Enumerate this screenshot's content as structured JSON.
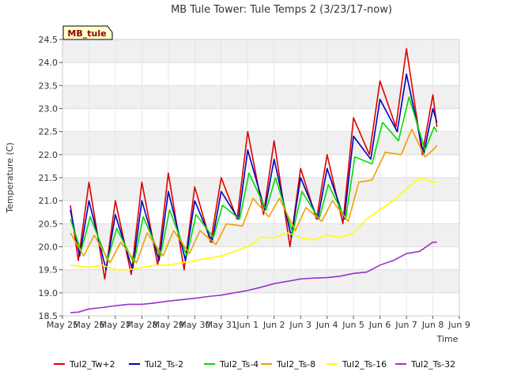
{
  "chart_data": {
    "type": "line",
    "title": "MB Tule Tower: Tule Temps 2 (3/23/17-now)",
    "xlabel": "Time",
    "ylabel": "Temperature (C)",
    "xlim": [
      0,
      15
    ],
    "ylim": [
      18.5,
      24.5
    ],
    "x_ticks": [
      0,
      1,
      2,
      3,
      4,
      5,
      6,
      7,
      8,
      9,
      10,
      11,
      12,
      13,
      14,
      15
    ],
    "x_tick_labels": [
      "May 25",
      "May 26",
      "May 27",
      "May 28",
      "May 29",
      "May 30",
      "May 31",
      "Jun 1",
      "Jun 2",
      "Jun 3",
      "Jun 4",
      "Jun 5",
      "Jun 6",
      "Jun 7",
      "Jun 8",
      "Jun 9"
    ],
    "y_ticks": [
      18.5,
      19.0,
      19.5,
      20.0,
      20.5,
      21.0,
      21.5,
      22.0,
      22.5,
      23.0,
      23.5,
      24.0,
      24.5
    ],
    "y_tick_labels": [
      "18.5",
      "19.0",
      "19.5",
      "20.0",
      "20.5",
      "21.0",
      "21.5",
      "22.0",
      "22.5",
      "23.0",
      "23.5",
      "24.0",
      "24.5"
    ],
    "grid": true,
    "legend_position": "bottom",
    "site_tag": "MB_tule",
    "series": [
      {
        "name": "Tul2_Tw+2",
        "color": "#dd0000",
        "points": [
          [
            0.3,
            20.9
          ],
          [
            0.6,
            19.7
          ],
          [
            1.0,
            21.4
          ],
          [
            1.6,
            19.3
          ],
          [
            2.0,
            21.0
          ],
          [
            2.6,
            19.4
          ],
          [
            3.0,
            21.4
          ],
          [
            3.6,
            19.6
          ],
          [
            4.0,
            21.6
          ],
          [
            4.6,
            19.5
          ],
          [
            5.0,
            21.3
          ],
          [
            5.6,
            20.1
          ],
          [
            6.0,
            21.5
          ],
          [
            6.6,
            20.6
          ],
          [
            7.0,
            22.5
          ],
          [
            7.6,
            20.7
          ],
          [
            8.0,
            22.3
          ],
          [
            8.6,
            20.0
          ],
          [
            9.0,
            21.7
          ],
          [
            9.6,
            20.6
          ],
          [
            10.0,
            22.0
          ],
          [
            10.6,
            20.5
          ],
          [
            11.0,
            22.8
          ],
          [
            11.6,
            22.0
          ],
          [
            12.0,
            23.6
          ],
          [
            12.6,
            22.6
          ],
          [
            13.0,
            24.3
          ],
          [
            13.6,
            22.0
          ],
          [
            14.0,
            23.3
          ],
          [
            14.15,
            22.6
          ]
        ]
      },
      {
        "name": "Tul2_Ts-2",
        "color": "#0000bb",
        "points": [
          [
            0.3,
            20.8
          ],
          [
            0.65,
            19.8
          ],
          [
            1.0,
            21.0
          ],
          [
            1.65,
            19.5
          ],
          [
            2.0,
            20.7
          ],
          [
            2.65,
            19.5
          ],
          [
            3.0,
            21.0
          ],
          [
            3.65,
            19.7
          ],
          [
            4.0,
            21.2
          ],
          [
            4.65,
            19.7
          ],
          [
            5.0,
            21.0
          ],
          [
            5.65,
            20.1
          ],
          [
            6.0,
            21.2
          ],
          [
            6.65,
            20.6
          ],
          [
            7.0,
            22.1
          ],
          [
            7.65,
            20.8
          ],
          [
            8.0,
            21.9
          ],
          [
            8.65,
            20.2
          ],
          [
            9.0,
            21.5
          ],
          [
            9.65,
            20.6
          ],
          [
            10.0,
            21.7
          ],
          [
            10.65,
            20.6
          ],
          [
            11.0,
            22.4
          ],
          [
            11.65,
            21.9
          ],
          [
            12.0,
            23.2
          ],
          [
            12.65,
            22.5
          ],
          [
            13.0,
            23.75
          ],
          [
            13.65,
            22.0
          ],
          [
            14.0,
            23.0
          ],
          [
            14.15,
            22.7
          ]
        ]
      },
      {
        "name": "Tul2_Ts-4",
        "color": "#00dd00",
        "points": [
          [
            0.3,
            20.6
          ],
          [
            0.7,
            19.9
          ],
          [
            1.05,
            20.65
          ],
          [
            1.7,
            19.7
          ],
          [
            2.05,
            20.4
          ],
          [
            2.7,
            19.65
          ],
          [
            3.05,
            20.65
          ],
          [
            3.7,
            19.8
          ],
          [
            4.05,
            20.8
          ],
          [
            4.7,
            19.8
          ],
          [
            5.05,
            20.7
          ],
          [
            5.7,
            20.2
          ],
          [
            6.05,
            20.9
          ],
          [
            6.7,
            20.6
          ],
          [
            7.05,
            21.6
          ],
          [
            7.7,
            20.8
          ],
          [
            8.05,
            21.5
          ],
          [
            8.7,
            20.3
          ],
          [
            9.05,
            21.2
          ],
          [
            9.7,
            20.6
          ],
          [
            10.05,
            21.35
          ],
          [
            10.7,
            20.6
          ],
          [
            11.05,
            21.95
          ],
          [
            11.7,
            21.8
          ],
          [
            12.1,
            22.7
          ],
          [
            12.7,
            22.3
          ],
          [
            13.1,
            23.25
          ],
          [
            13.7,
            22.1
          ],
          [
            14.05,
            22.6
          ],
          [
            14.15,
            22.5
          ]
        ]
      },
      {
        "name": "Tul2_Ts-8",
        "color": "#f0a000",
        "points": [
          [
            0.3,
            20.3
          ],
          [
            0.8,
            19.8
          ],
          [
            1.2,
            20.25
          ],
          [
            1.8,
            19.65
          ],
          [
            2.2,
            20.1
          ],
          [
            2.8,
            19.65
          ],
          [
            3.2,
            20.3
          ],
          [
            3.8,
            19.8
          ],
          [
            4.2,
            20.35
          ],
          [
            4.8,
            19.85
          ],
          [
            5.2,
            20.35
          ],
          [
            5.8,
            20.05
          ],
          [
            6.2,
            20.5
          ],
          [
            6.8,
            20.45
          ],
          [
            7.2,
            21.05
          ],
          [
            7.8,
            20.65
          ],
          [
            8.2,
            21.05
          ],
          [
            8.8,
            20.35
          ],
          [
            9.2,
            20.85
          ],
          [
            9.8,
            20.55
          ],
          [
            10.2,
            21.0
          ],
          [
            10.8,
            20.55
          ],
          [
            11.2,
            21.4
          ],
          [
            11.7,
            21.45
          ],
          [
            12.2,
            22.05
          ],
          [
            12.8,
            22.0
          ],
          [
            13.2,
            22.55
          ],
          [
            13.7,
            21.95
          ],
          [
            14.0,
            22.1
          ],
          [
            14.15,
            22.2
          ]
        ]
      },
      {
        "name": "Tul2_Ts-16",
        "color": "#ffff00",
        "points": [
          [
            0.3,
            19.6
          ],
          [
            1.0,
            19.55
          ],
          [
            1.5,
            19.6
          ],
          [
            2.0,
            19.5
          ],
          [
            2.5,
            19.5
          ],
          [
            3.0,
            19.55
          ],
          [
            3.5,
            19.6
          ],
          [
            4.0,
            19.6
          ],
          [
            4.5,
            19.65
          ],
          [
            5.0,
            19.7
          ],
          [
            5.5,
            19.75
          ],
          [
            6.0,
            19.8
          ],
          [
            6.5,
            19.9
          ],
          [
            7.0,
            20.0
          ],
          [
            7.5,
            20.2
          ],
          [
            8.0,
            20.2
          ],
          [
            8.5,
            20.3
          ],
          [
            9.0,
            20.2
          ],
          [
            9.5,
            20.15
          ],
          [
            10.0,
            20.25
          ],
          [
            10.5,
            20.2
          ],
          [
            11.0,
            20.3
          ],
          [
            11.5,
            20.6
          ],
          [
            12.0,
            20.8
          ],
          [
            12.5,
            21.0
          ],
          [
            13.0,
            21.25
          ],
          [
            13.5,
            21.5
          ],
          [
            14.0,
            21.4
          ],
          [
            14.15,
            21.4
          ]
        ]
      },
      {
        "name": "Tul2_Ts-32",
        "color": "#9933cc",
        "points": [
          [
            0.3,
            18.57
          ],
          [
            0.6,
            18.58
          ],
          [
            1.0,
            18.65
          ],
          [
            1.5,
            18.68
          ],
          [
            2.0,
            18.72
          ],
          [
            2.5,
            18.75
          ],
          [
            3.0,
            18.75
          ],
          [
            3.5,
            18.78
          ],
          [
            4.0,
            18.82
          ],
          [
            4.5,
            18.85
          ],
          [
            5.0,
            18.88
          ],
          [
            5.5,
            18.92
          ],
          [
            6.0,
            18.95
          ],
          [
            6.5,
            19.0
          ],
          [
            7.0,
            19.05
          ],
          [
            7.5,
            19.12
          ],
          [
            8.0,
            19.2
          ],
          [
            8.5,
            19.25
          ],
          [
            9.0,
            19.3
          ],
          [
            9.5,
            19.32
          ],
          [
            10.0,
            19.33
          ],
          [
            10.5,
            19.36
          ],
          [
            11.0,
            19.42
          ],
          [
            11.5,
            19.45
          ],
          [
            12.0,
            19.6
          ],
          [
            12.5,
            19.7
          ],
          [
            13.0,
            19.85
          ],
          [
            13.5,
            19.9
          ],
          [
            14.0,
            20.1
          ],
          [
            14.15,
            20.1
          ]
        ]
      }
    ]
  }
}
